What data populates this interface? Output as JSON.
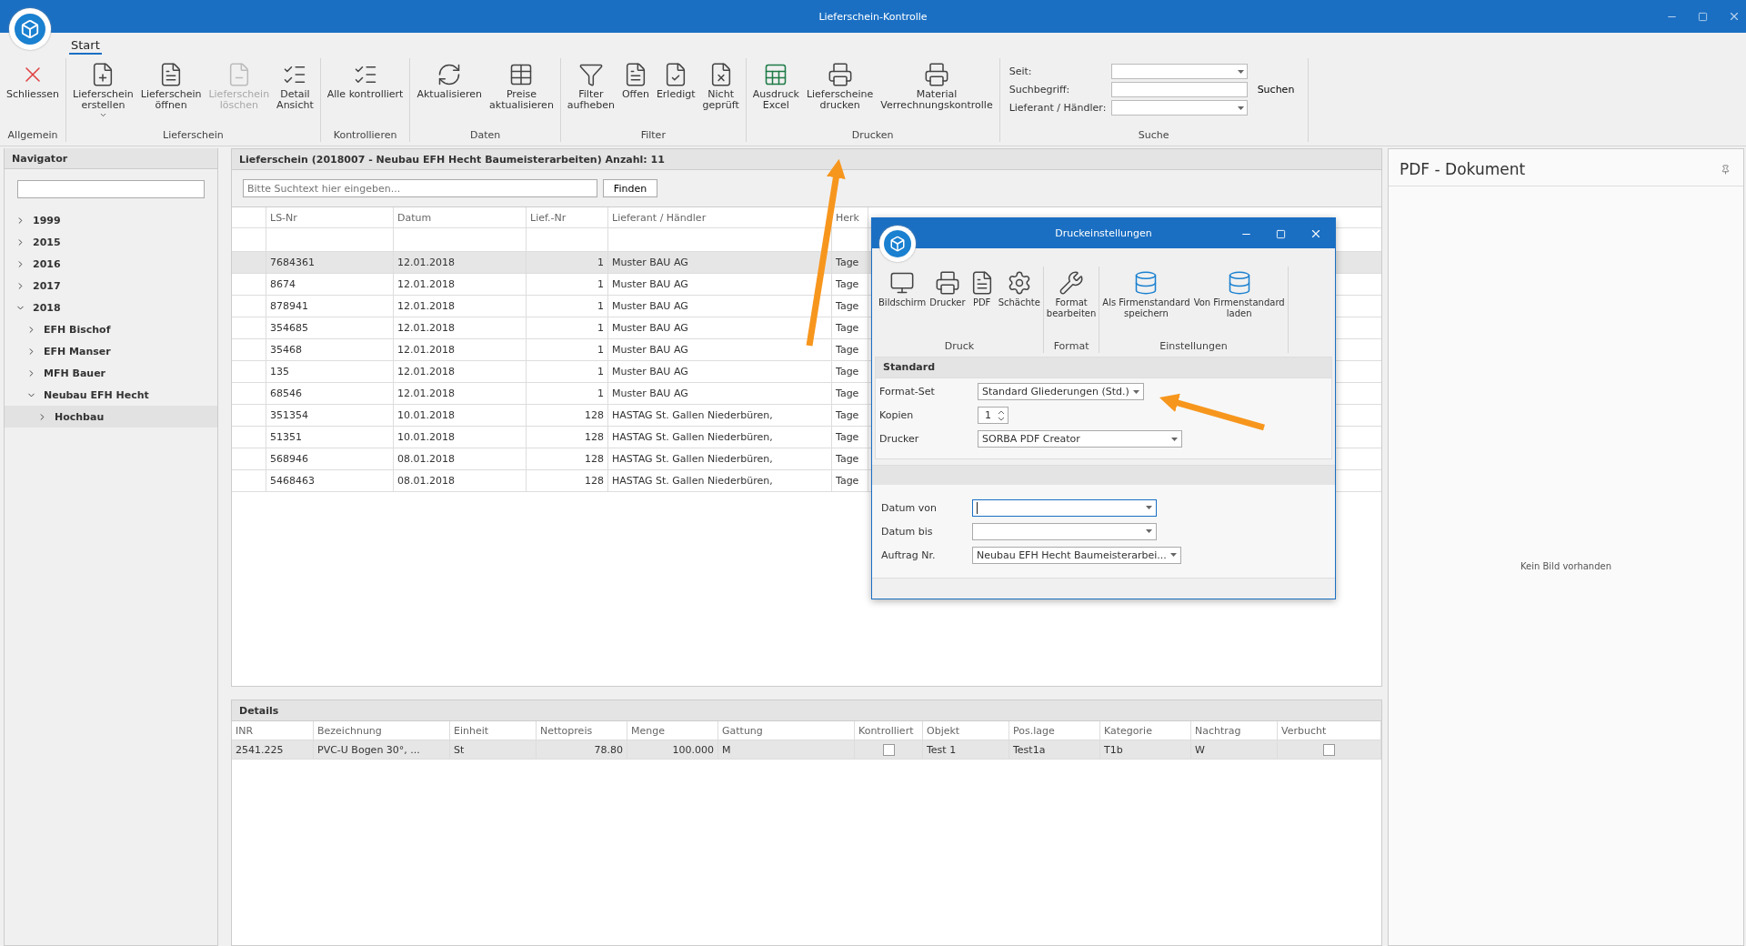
{
  "window": {
    "title": "Lieferschein-Kontrolle"
  },
  "ribbon": {
    "tabs": [
      {
        "label": "Start",
        "selected": true
      }
    ],
    "groups": [
      {
        "label": "Allgemein",
        "buttons": [
          {
            "lines": [
              "Schliessen"
            ],
            "disabled": false
          }
        ]
      },
      {
        "label": "Lieferschein",
        "buttons": [
          {
            "lines": [
              "Lieferschein",
              "erstellen"
            ],
            "disabled": false,
            "dropdown": true
          },
          {
            "lines": [
              "Lieferschein",
              "öffnen"
            ],
            "disabled": false
          },
          {
            "lines": [
              "Lieferschein",
              "löschen"
            ],
            "disabled": true
          },
          {
            "lines": [
              "Detail",
              "Ansicht"
            ],
            "disabled": false
          }
        ]
      },
      {
        "label": "Kontrollieren",
        "buttons": [
          {
            "lines": [
              "Alle kontrolliert"
            ],
            "disabled": false
          }
        ]
      },
      {
        "label": "Daten",
        "buttons": [
          {
            "lines": [
              "Aktualisieren"
            ],
            "disabled": false
          },
          {
            "lines": [
              "Preise",
              "aktualisieren"
            ],
            "disabled": false
          }
        ]
      },
      {
        "label": "Filter",
        "buttons": [
          {
            "lines": [
              "Filter",
              "aufheben"
            ],
            "disabled": false
          },
          {
            "lines": [
              "Offen"
            ],
            "disabled": false
          },
          {
            "lines": [
              "Erledigt"
            ],
            "disabled": false
          },
          {
            "lines": [
              "Nicht",
              "geprüft"
            ],
            "disabled": false
          }
        ]
      },
      {
        "label": "Drucken",
        "buttons": [
          {
            "lines": [
              "Ausdruck",
              "Excel"
            ],
            "disabled": false
          },
          {
            "lines": [
              "Lieferscheine",
              "drucken"
            ],
            "disabled": false
          },
          {
            "lines": [
              "Material",
              "Verrechnungskontrolle"
            ],
            "disabled": false
          }
        ]
      }
    ],
    "search": {
      "label": "Suche",
      "fields": [
        {
          "label": "Seit:",
          "kind": "dropdown"
        },
        {
          "label": "Suchbegriff:",
          "kind": "text",
          "action": "Suchen"
        },
        {
          "label": "Lieferant / Händler:",
          "kind": "dropdown"
        }
      ]
    }
  },
  "navigator": {
    "title": "Navigator",
    "tree": [
      {
        "label": "1999",
        "expanded": false,
        "selected": false
      },
      {
        "label": "2015",
        "expanded": false,
        "selected": false
      },
      {
        "label": "2016",
        "expanded": false,
        "selected": false
      },
      {
        "label": "2017",
        "expanded": false,
        "selected": false
      },
      {
        "label": "2018",
        "expanded": true,
        "selected": false,
        "children": [
          {
            "label": "EFH Bischof",
            "expanded": false,
            "selected": false
          },
          {
            "label": "EFH Manser",
            "expanded": false,
            "selected": false
          },
          {
            "label": "MFH Bauer",
            "expanded": false,
            "selected": false
          },
          {
            "label": "Neubau EFH Hecht",
            "expanded": true,
            "selected": false,
            "children": [
              {
                "label": "Hochbau",
                "expanded": false,
                "selected": true
              }
            ]
          }
        ]
      }
    ]
  },
  "delivery_notes": {
    "title": "Lieferschein (2018007 - Neubau EFH Hecht Baumeisterarbeiten) Anzahl: 11",
    "search_placeholder": "Bitte Suchtext hier eingeben...",
    "find_button": "Finden",
    "columns": [
      {
        "label": "LS-Nr",
        "kind": "text"
      },
      {
        "label": "Datum",
        "kind": "text"
      },
      {
        "label": "Lief.-Nr",
        "kind": "number"
      },
      {
        "label": "Lieferant / Händler",
        "kind": "text"
      },
      {
        "label": "Herk",
        "kind": "text"
      }
    ],
    "rows": [
      {
        "cells": [
          "7684361",
          "12.01.2018",
          "1",
          "Muster BAU AG",
          "Tage"
        ],
        "selected": true
      },
      {
        "cells": [
          "8674",
          "12.01.2018",
          "1",
          "Muster BAU AG",
          "Tage"
        ],
        "selected": false
      },
      {
        "cells": [
          "878941",
          "12.01.2018",
          "1",
          "Muster BAU AG",
          "Tage"
        ],
        "selected": false
      },
      {
        "cells": [
          "354685",
          "12.01.2018",
          "1",
          "Muster BAU AG",
          "Tage"
        ],
        "selected": false
      },
      {
        "cells": [
          "35468",
          "12.01.2018",
          "1",
          "Muster BAU AG",
          "Tage"
        ],
        "selected": false
      },
      {
        "cells": [
          "135",
          "12.01.2018",
          "1",
          "Muster BAU AG",
          "Tage"
        ],
        "selected": false
      },
      {
        "cells": [
          "68546",
          "12.01.2018",
          "1",
          "Muster BAU AG",
          "Tage"
        ],
        "selected": false
      },
      {
        "cells": [
          "351354",
          "10.01.2018",
          "128",
          "HASTAG St. Gallen Niederbüren,",
          "Tage"
        ],
        "selected": false
      },
      {
        "cells": [
          "51351",
          "10.01.2018",
          "128",
          "HASTAG St. Gallen Niederbüren,",
          "Tage"
        ],
        "selected": false
      },
      {
        "cells": [
          "568946",
          "08.01.2018",
          "128",
          "HASTAG St. Gallen Niederbüren,",
          "Tage"
        ],
        "selected": false
      },
      {
        "cells": [
          "5468463",
          "08.01.2018",
          "128",
          "HASTAG St. Gallen Niederbüren,",
          "Tage"
        ],
        "selected": false
      }
    ]
  },
  "details": {
    "title": "Details",
    "columns": [
      {
        "label": "INR",
        "kind": "text"
      },
      {
        "label": "Bezeichnung",
        "kind": "text"
      },
      {
        "label": "Einheit",
        "kind": "text"
      },
      {
        "label": "Nettopreis",
        "kind": "number"
      },
      {
        "label": "Menge",
        "kind": "number"
      },
      {
        "label": "Gattung",
        "kind": "text"
      },
      {
        "label": "Kontrolliert",
        "kind": "checkbox"
      },
      {
        "label": "Objekt",
        "kind": "text"
      },
      {
        "label": "Pos.lage",
        "kind": "text"
      },
      {
        "label": "Kategorie",
        "kind": "text"
      },
      {
        "label": "Nachtrag",
        "kind": "text"
      },
      {
        "label": "Verbucht",
        "kind": "checkbox"
      }
    ],
    "rows": [
      {
        "cells": [
          {
            "text": "2541.225"
          },
          {
            "text": "PVC-U Bogen 30°, ..."
          },
          {
            "text": "St"
          },
          {
            "text": "78.80"
          },
          {
            "text": "100.000"
          },
          {
            "text": "M"
          },
          {
            "checked": false
          },
          {
            "text": "Test 1"
          },
          {
            "text": "Test1a"
          },
          {
            "text": "T1b"
          },
          {
            "text": "W"
          },
          {
            "checked": false
          }
        ]
      }
    ]
  },
  "pdf_panel": {
    "title": "PDF - Dokument",
    "empty_message": "Kein Bild vorhanden"
  },
  "dialog": {
    "title": "Druckeinstellungen",
    "groups": [
      {
        "label": "Druck",
        "buttons": [
          {
            "lines": [
              "Bildschirm"
            ]
          },
          {
            "lines": [
              "Drucker"
            ]
          },
          {
            "lines": [
              "PDF"
            ]
          },
          {
            "lines": [
              "Schächte"
            ]
          }
        ]
      },
      {
        "label": "Format",
        "buttons": [
          {
            "lines": [
              "Format",
              "bearbeiten"
            ]
          }
        ]
      },
      {
        "label": "Einstellungen",
        "buttons": [
          {
            "lines": [
              "Als Firmenstandard",
              "speichern"
            ]
          },
          {
            "lines": [
              "Von Firmenstandard",
              "laden"
            ]
          }
        ]
      }
    ],
    "standard": {
      "title": "Standard",
      "fields": [
        {
          "label": "Format-Set",
          "kind": "dropdown",
          "value": "Standard Gliederungen (Std.)"
        },
        {
          "label": "Kopien",
          "kind": "spinner",
          "value": "1"
        },
        {
          "label": "Drucker",
          "kind": "dropdown-wide",
          "value": "SORBA PDF Creator"
        }
      ]
    },
    "filters": [
      {
        "label": "Datum von",
        "kind": "dropdown",
        "focused": true
      },
      {
        "label": "Datum bis",
        "kind": "dropdown",
        "focused": false
      },
      {
        "label": "Auftrag Nr.",
        "kind": "dropdown",
        "value": "Neubau EFH Hecht Baumeisterarbei...",
        "focused": false
      }
    ]
  }
}
